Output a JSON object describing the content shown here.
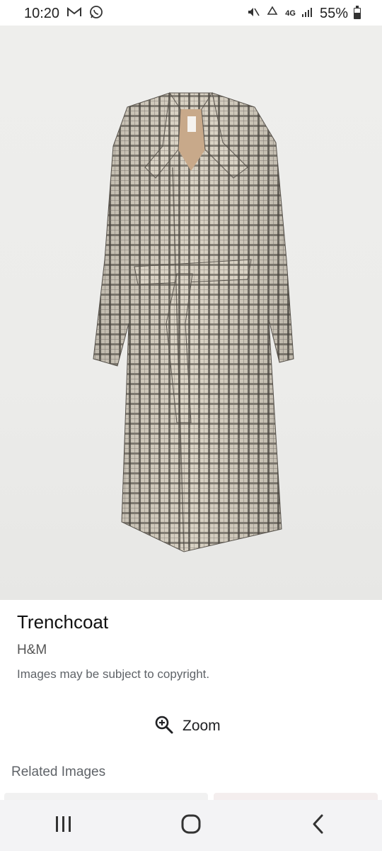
{
  "status_bar": {
    "time": "10:20",
    "network": "4G",
    "battery": "55%",
    "battery_level": 0.55
  },
  "product": {
    "title": "Trenchcoat",
    "brand": "H&M",
    "notice": "Images may be subject to copyright."
  },
  "actions": {
    "zoom_label": "Zoom"
  },
  "related": {
    "title": "Related Images"
  },
  "icons": [
    "gmail-icon",
    "whatsapp-icon",
    "mute-icon",
    "recycle-icon",
    "signal-icon",
    "battery-icon",
    "zoom-in-icon",
    "recents-icon",
    "home-icon",
    "back-icon"
  ]
}
